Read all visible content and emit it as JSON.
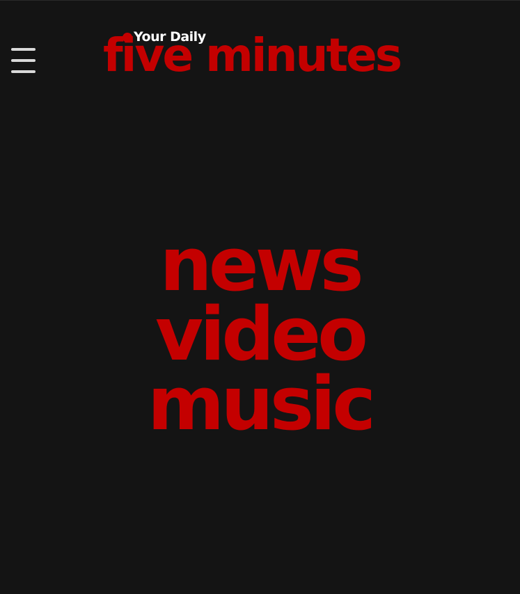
{
  "header": {
    "menu_icon": "hamburger-menu-icon",
    "logo": {
      "tagline": "Your Daily",
      "name": "five minutes"
    }
  },
  "hero": {
    "words": [
      "news",
      "video",
      "music"
    ]
  },
  "colors": {
    "background": "#141414",
    "brand_red": "#c40000",
    "menu_icon": "#d9d9d9",
    "tagline_text": "#ffffff"
  }
}
